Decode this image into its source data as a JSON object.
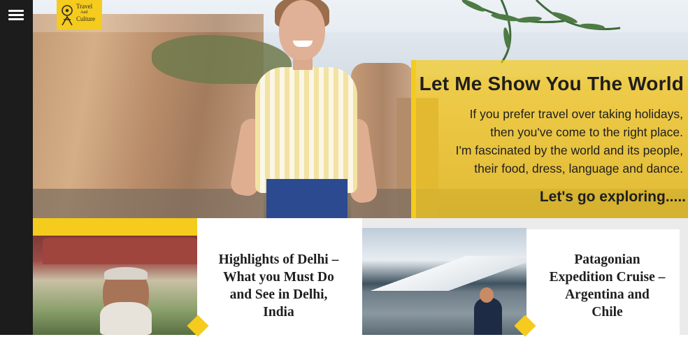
{
  "sidebar": {
    "menu_icon": "hamburger-menu-icon"
  },
  "logo": {
    "line1": "Travel",
    "line2": "And",
    "line3": "Culture",
    "mark_icon": "globe-person-icon"
  },
  "hero": {
    "heading": "Let Me Show You The World",
    "lines": [
      "If you prefer travel over taking holidays,",
      "then you've come to the right place.",
      "I'm fascinated by the world and its people,",
      "their food, dress, language and dance."
    ],
    "cta": "Let's go exploring....."
  },
  "cards": [
    {
      "title": "Highlights of Delhi – What you Must Do and See in Delhi, India"
    },
    {
      "title": "Patagonian Expedition Cruise – Argentina and Chile"
    }
  ],
  "colors": {
    "accent": "#f5cb1d",
    "sidebar": "#1c1c1c",
    "text": "#1e1e1e"
  }
}
